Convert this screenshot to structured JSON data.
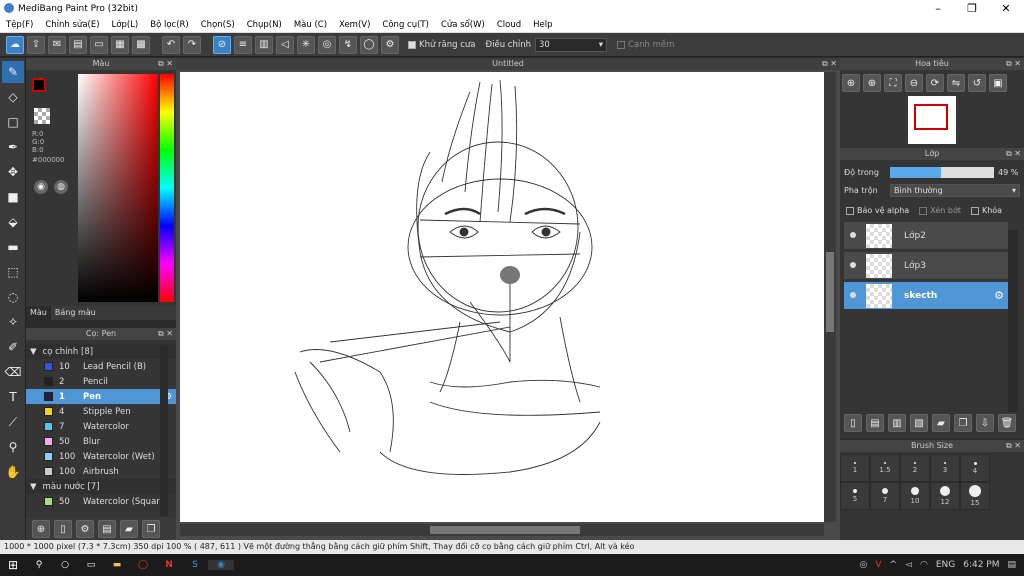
{
  "app": {
    "title": "MediBang Paint Pro (32bit)"
  },
  "menu": [
    "Tệp(F)",
    "Chỉnh sửa(E)",
    "Lớp(L)",
    "Bộ lọc(R)",
    "Chọn(S)",
    "Chụp(N)",
    "Màu (C)",
    "Xem(V)",
    "Công cụ(T)",
    "Cửa sổ(W)",
    "Cloud",
    "Help"
  ],
  "toolbar": {
    "antialias_label": "Khử răng cưa",
    "correction_label": "Điều chỉnh",
    "correction_value": "30",
    "snap_label": "Cạnh mềm"
  },
  "color_panel": {
    "title": "Màu",
    "r": "R:0",
    "g": "G:0",
    "b": "B:0",
    "hex": "#000000",
    "tab_color": "Màu",
    "tab_palette": "Bảng màu"
  },
  "canvas": {
    "title": "Untitled"
  },
  "brush_panel": {
    "title": "Cọ: Pen",
    "group1": "cọ chính [8]",
    "group2": "màu nước [7]",
    "items": [
      {
        "size": "10",
        "name": "Lead Pencil (B)",
        "color": "#3355ee"
      },
      {
        "size": "2",
        "name": "Pencil",
        "color": "#222222"
      },
      {
        "size": "1",
        "name": "Pen",
        "color": "#222244"
      },
      {
        "size": "4",
        "name": "Stipple Pen",
        "color": "#f2d21c"
      },
      {
        "size": "7",
        "name": "Watercolor",
        "color": "#55c8f0"
      },
      {
        "size": "50",
        "name": "Blur",
        "color": "#f7a8f0"
      },
      {
        "size": "100",
        "name": "Watercolor (Wet)",
        "color": "#8fd0f7"
      },
      {
        "size": "100",
        "name": "Airbrush",
        "color": "#cccccc"
      }
    ],
    "group2_first": {
      "size": "50",
      "name": "Watercolor (Squar",
      "color": "#a6e07a"
    }
  },
  "nav_panel": {
    "title": "Hoa tiêu"
  },
  "layer_panel": {
    "title": "Lớp",
    "opacity_label": "Độ trong",
    "opacity_value": "49 %",
    "opacity": 0.49,
    "blend_label": "Pha trộn",
    "blend_value": "Bình thường",
    "protect_alpha": "Bảo vệ alpha",
    "clip": "Xén bớt",
    "lock": "Khóa",
    "layers": [
      {
        "name": "Lớp2"
      },
      {
        "name": "Lớp3"
      },
      {
        "name": "skecth"
      }
    ]
  },
  "size_panel": {
    "title": "Brush Size",
    "labels": [
      "1",
      "1.5",
      "2",
      "3",
      "4",
      "5",
      "7",
      "10",
      "12",
      "15"
    ]
  },
  "status": {
    "text": "1000 * 1000 pixel  (7.3 * 7.3cm)  350 dpi  100 %  ( 487, 611 )  Vẽ một đường thẳng bằng cách giữ phím Shift, Thay đổi cỡ cọ bằng cách giữ phím Ctrl, Alt và kéo"
  },
  "taskbar": {
    "lang": "ENG",
    "time": "6:42 PM"
  }
}
